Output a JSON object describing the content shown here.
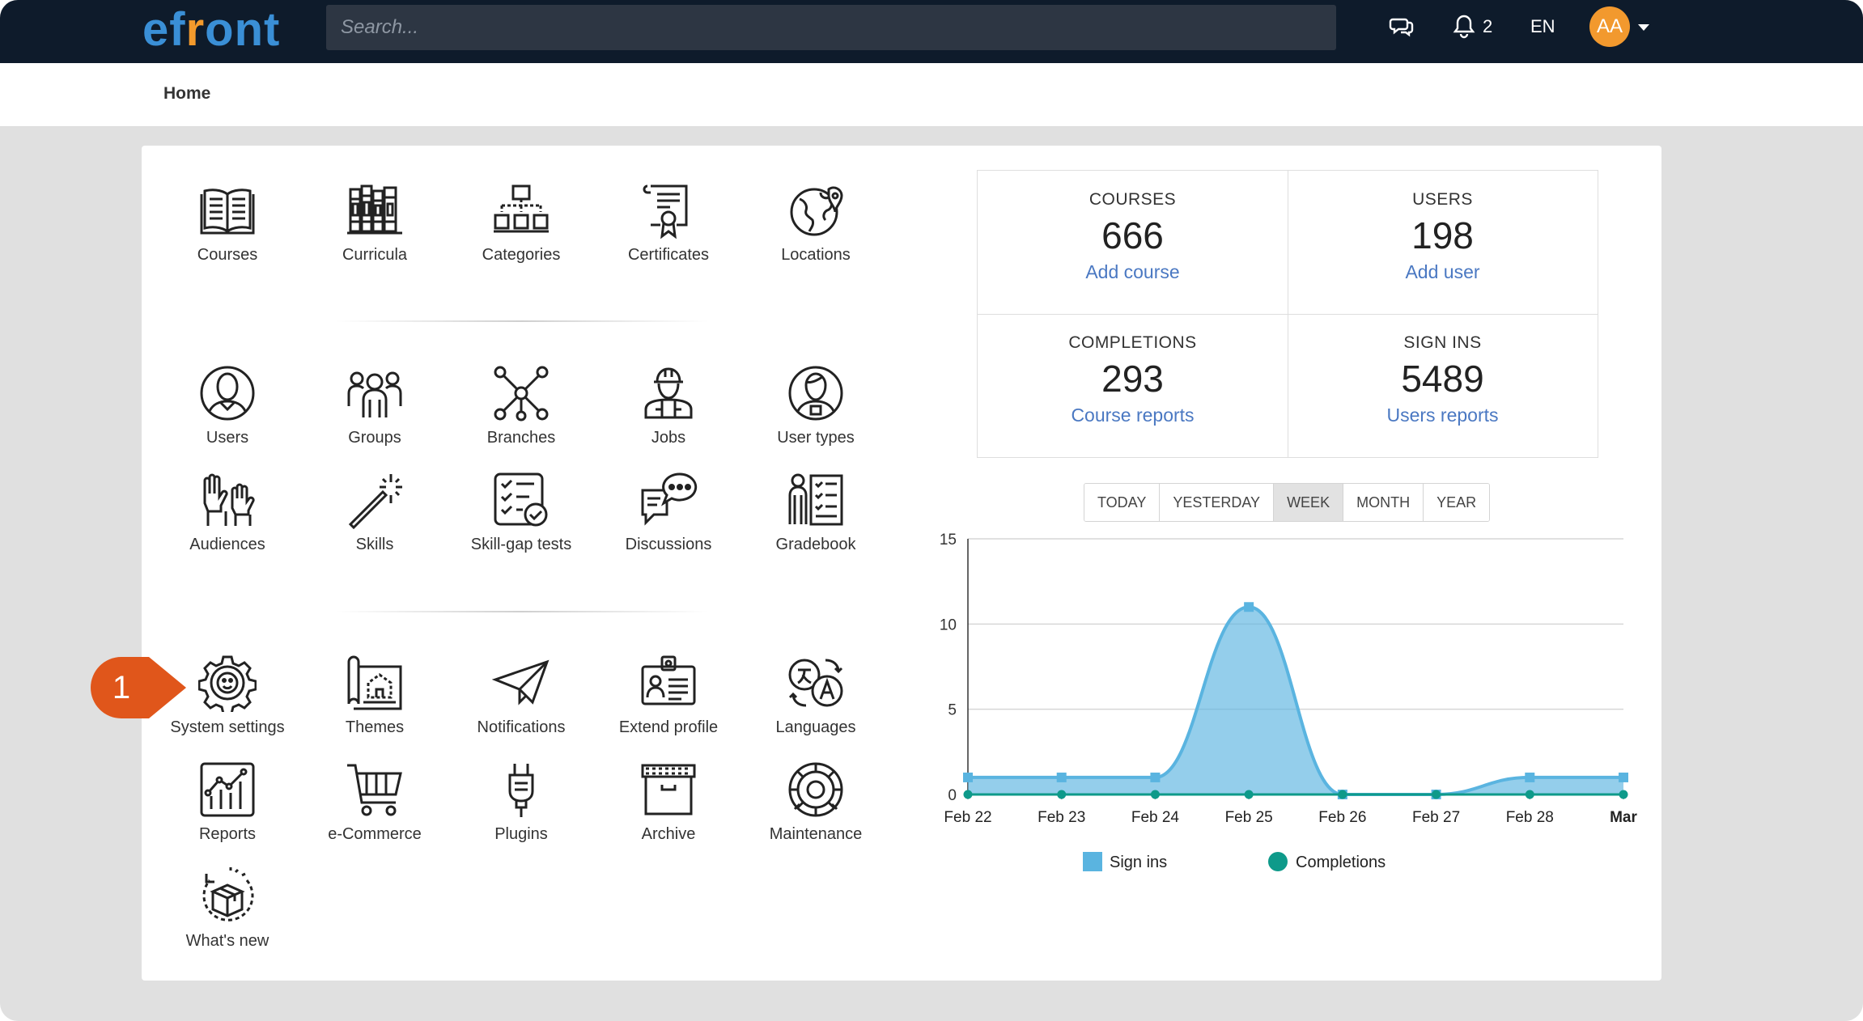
{
  "app": {
    "logo_text": "efront",
    "brand_blue": "#3a8fd6",
    "brand_orange": "#f39a2c"
  },
  "header": {
    "search_placeholder": "Search...",
    "notifications_count": "2",
    "language": "EN",
    "avatar_initials": "AA"
  },
  "breadcrumb": {
    "home": "Home"
  },
  "callout": {
    "number": "1",
    "color": "#e0561b"
  },
  "tiles": {
    "courses": "Courses",
    "curricula": "Curricula",
    "categories": "Categories",
    "certificates": "Certificates",
    "locations": "Locations",
    "users": "Users",
    "groups": "Groups",
    "branches": "Branches",
    "jobs": "Jobs",
    "user_types": "User types",
    "audiences": "Audiences",
    "skills": "Skills",
    "skill_gap_tests": "Skill-gap tests",
    "discussions": "Discussions",
    "gradebook": "Gradebook",
    "system_settings": "System settings",
    "themes": "Themes",
    "notifications": "Notifications",
    "extend_profile": "Extend profile",
    "languages": "Languages",
    "reports": "Reports",
    "ecommerce": "e-Commerce",
    "plugins": "Plugins",
    "archive": "Archive",
    "maintenance": "Maintenance",
    "whats_new": "What's new"
  },
  "stats": {
    "courses": {
      "title": "COURSES",
      "value": "666",
      "action": "Add course"
    },
    "users": {
      "title": "USERS",
      "value": "198",
      "action": "Add user"
    },
    "completions": {
      "title": "COMPLETIONS",
      "value": "293",
      "action": "Course reports"
    },
    "signins": {
      "title": "SIGN INS",
      "value": "5489",
      "action": "Users reports"
    }
  },
  "periods": {
    "today": "TODAY",
    "yesterday": "YESTERDAY",
    "week": "WEEK",
    "month": "MONTH",
    "year": "YEAR",
    "active": "WEEK"
  },
  "chart_data": {
    "type": "area",
    "x": [
      "Feb 22",
      "Feb 23",
      "Feb 24",
      "Feb 25",
      "Feb 26",
      "Feb 27",
      "Feb 28",
      "Mar"
    ],
    "ylim": [
      0,
      15
    ],
    "yticks": [
      0,
      5,
      10,
      15
    ],
    "grid": true,
    "legend_position": "bottom",
    "series": [
      {
        "name": "Sign ins",
        "values": [
          1,
          1,
          1,
          11,
          0,
          0,
          1,
          1
        ],
        "color": "#5ab4e0"
      },
      {
        "name": "Completions",
        "values": [
          0,
          0,
          0,
          0,
          0,
          0,
          0,
          0
        ],
        "color": "#0e9a8a"
      }
    ]
  }
}
